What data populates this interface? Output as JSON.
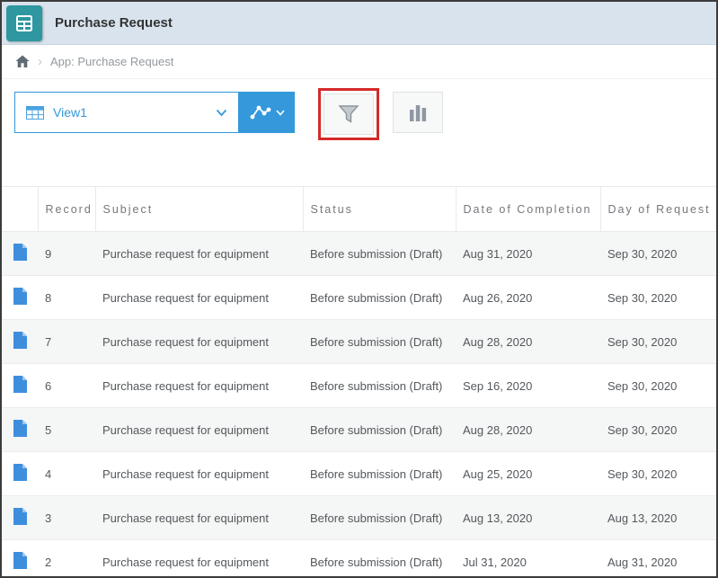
{
  "app": {
    "title": "Purchase Request",
    "breadcrumb": "App: Purchase Request",
    "breadcrumb_separator": "›"
  },
  "toolbar": {
    "view_selector": "View1"
  },
  "icons": {
    "app": "table-app-icon",
    "home": "home-icon",
    "view": "table-view-icon",
    "graph": "line-graph-icon",
    "filter": "funnel-icon",
    "chart": "bar-chart-icon",
    "row_doc": "document-icon",
    "chevron": "chevron-down-icon"
  },
  "colors": {
    "accent_blue": "#3498db",
    "app_icon_teal": "#2e97a0",
    "annotation_red": "#d42a2a",
    "titlebar_bg": "#d9e3ed"
  },
  "table": {
    "columns": [
      "Record",
      "Subject",
      "Status",
      "Date of Completion",
      "Day of Request"
    ],
    "rows": [
      {
        "record": "9",
        "subject": "Purchase request for equipment",
        "status": "Before submission (Draft)",
        "date_of_completion": "Aug 31, 2020",
        "day_of_request": "Sep 30, 2020"
      },
      {
        "record": "8",
        "subject": "Purchase request for equipment",
        "status": "Before submission (Draft)",
        "date_of_completion": "Aug 26, 2020",
        "day_of_request": "Sep 30, 2020"
      },
      {
        "record": "7",
        "subject": "Purchase request for equipment",
        "status": "Before submission (Draft)",
        "date_of_completion": "Aug 28, 2020",
        "day_of_request": "Sep 30, 2020"
      },
      {
        "record": "6",
        "subject": "Purchase request for equipment",
        "status": "Before submission (Draft)",
        "date_of_completion": "Sep 16, 2020",
        "day_of_request": "Sep 30, 2020"
      },
      {
        "record": "5",
        "subject": "Purchase request for equipment",
        "status": "Before submission (Draft)",
        "date_of_completion": "Aug 28, 2020",
        "day_of_request": "Sep 30, 2020"
      },
      {
        "record": "4",
        "subject": "Purchase request for equipment",
        "status": "Before submission (Draft)",
        "date_of_completion": "Aug 25, 2020",
        "day_of_request": "Sep 30, 2020"
      },
      {
        "record": "3",
        "subject": "Purchase request for equipment",
        "status": "Before submission (Draft)",
        "date_of_completion": "Aug 13, 2020",
        "day_of_request": "Aug 13, 2020"
      },
      {
        "record": "2",
        "subject": "Purchase request for equipment",
        "status": "Before submission (Draft)",
        "date_of_completion": "Jul 31, 2020",
        "day_of_request": "Aug 31, 2020"
      }
    ]
  }
}
